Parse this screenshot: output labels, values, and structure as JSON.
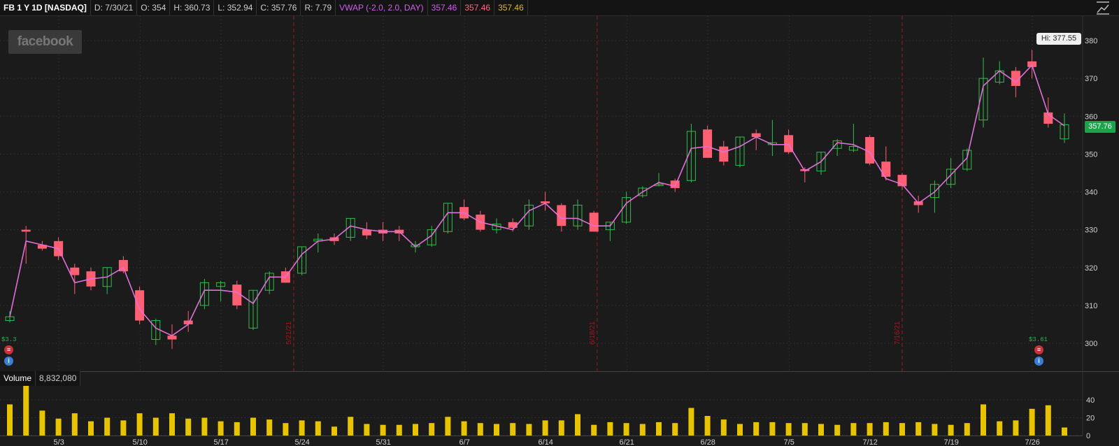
{
  "header": {
    "symbol": "FB 1 Y 1D [NASDAQ]",
    "date": "D: 7/30/21",
    "open": "O: 354",
    "high": "H: 360.73",
    "low": "L: 352.94",
    "close": "C: 357.76",
    "range": "R: 7.79",
    "study": "VWAP (-2.0, 2.0, DAY)",
    "study_values": [
      "357.46",
      "357.46",
      "357.46"
    ]
  },
  "logo_text": "facebook",
  "last_price": "357.76",
  "high_label": "Hi: 377.55",
  "volume_panel": {
    "title": "Volume",
    "value": "8,832,080"
  },
  "events": [
    {
      "label": "$3.3"
    },
    {
      "label": "$3.61"
    }
  ],
  "colors": {
    "up": "#2fbf4a",
    "down": "#ff5f73",
    "vwap": "#e070d8",
    "volume": "#e8c400",
    "separator": "#a0181c",
    "grid": "#3b3b3b",
    "price_tag": "#1aa34a"
  },
  "chart_data": [
    {
      "type": "candlestick",
      "title": "FB 1 Y 1D [NASDAQ]",
      "y_axis_side": "right",
      "ylim": [
        295,
        383
      ],
      "yticks": [
        300,
        310,
        320,
        330,
        340,
        350,
        360,
        370,
        380
      ],
      "xtick_labels": [
        "5/3",
        "5/10",
        "5/17",
        "5/24",
        "5/31",
        "6/7",
        "6/14",
        "6/21",
        "6/28",
        "7/5",
        "7/12",
        "7/19",
        "7/26"
      ],
      "month_separators": [
        "5/21/21",
        "6/18/21",
        "7/16/21"
      ],
      "grid": true,
      "series": [
        {
          "name": "price",
          "ohlc": [
            [
              306,
              308.5,
              305.5,
              307
            ],
            [
              330,
              331,
              321,
              329.5
            ],
            [
              326,
              327,
              324.5,
              325
            ],
            [
              327,
              328,
              322,
              323
            ],
            [
              320,
              321,
              313,
              318
            ],
            [
              319,
              320,
              314,
              315
            ],
            [
              315,
              320,
              313,
              320
            ],
            [
              322,
              323,
              318.5,
              319
            ],
            [
              314,
              315,
              305,
              306
            ],
            [
              301,
              306.5,
              299.5,
              306
            ],
            [
              302,
              305,
              298.5,
              301
            ],
            [
              306,
              308.5,
              303,
              305
            ],
            [
              310,
              317,
              309,
              316
            ],
            [
              315,
              316.5,
              311,
              316
            ],
            [
              315.5,
              316.5,
              309,
              310
            ],
            [
              304,
              314,
              303.5,
              314
            ],
            [
              314,
              319,
              313,
              318.5
            ],
            [
              319,
              320,
              316,
              316
            ],
            [
              318.5,
              325.5,
              318,
              325.5
            ],
            [
              327,
              329,
              324,
              327.5
            ],
            [
              328,
              329,
              326,
              327
            ],
            [
              328,
              333,
              327,
              333
            ],
            [
              330,
              332,
              327.5,
              328.5
            ],
            [
              330,
              332,
              327,
              329
            ],
            [
              330,
              331,
              327,
              329
            ],
            [
              325.5,
              327,
              324,
              326
            ],
            [
              326,
              331,
              325.5,
              330
            ],
            [
              329.5,
              337,
              329,
              337
            ],
            [
              336,
              338,
              332.5,
              333
            ],
            [
              334,
              335,
              329.5,
              330
            ],
            [
              330,
              333,
              329,
              331.5
            ],
            [
              332,
              333,
              329.5,
              330.5
            ],
            [
              331,
              338,
              330,
              336.5
            ],
            [
              337.5,
              340,
              335,
              337
            ],
            [
              336.5,
              337,
              329.5,
              331
            ],
            [
              331,
              338,
              330,
              336.5
            ],
            [
              334.5,
              335,
              329.5,
              329.5
            ],
            [
              330,
              332,
              327,
              332
            ],
            [
              332,
              340,
              331.5,
              338.5
            ],
            [
              339,
              341.5,
              338.5,
              341
            ],
            [
              342,
              345,
              341.5,
              342
            ],
            [
              343,
              343.5,
              340,
              341
            ],
            [
              343,
              358,
              342.5,
              356
            ],
            [
              356.5,
              357.5,
              349,
              349
            ],
            [
              352,
              353.5,
              347,
              348
            ],
            [
              347,
              354.5,
              346.5,
              354.5
            ],
            [
              355.5,
              356.5,
              351,
              354.5
            ],
            [
              352.5,
              359,
              349.5,
              353
            ],
            [
              355,
              356.5,
              350,
              350.5
            ],
            [
              346,
              346.5,
              342.5,
              345.5
            ],
            [
              345.5,
              350.5,
              344.5,
              350.5
            ],
            [
              351.5,
              354,
              349.5,
              353.5
            ],
            [
              351,
              358,
              350.5,
              352
            ],
            [
              354.5,
              355,
              347,
              347.5
            ],
            [
              348,
              352,
              343,
              344
            ],
            [
              344.5,
              345,
              340.5,
              341.5
            ],
            [
              337.5,
              339,
              334.5,
              336.5
            ],
            [
              338.5,
              343,
              334.5,
              342
            ],
            [
              342,
              349,
              341,
              346
            ],
            [
              346,
              351.5,
              345.5,
              351
            ],
            [
              359,
              375.5,
              357,
              370
            ],
            [
              369,
              374.5,
              368.5,
              372
            ],
            [
              372,
              373,
              365,
              368
            ],
            [
              374.5,
              377.55,
              370,
              373
            ],
            [
              361,
              365,
              357,
              358
            ],
            [
              354,
              360.73,
              352.94,
              357.76
            ]
          ]
        },
        {
          "name": "VWAP",
          "values": [
            307,
            327,
            326,
            325,
            316,
            317,
            317.5,
            320,
            309,
            304,
            302,
            305,
            314,
            314,
            313.5,
            310.5,
            317.5,
            317.5,
            323.5,
            327,
            327.5,
            331,
            330,
            329.5,
            329.5,
            325.5,
            328.5,
            334.5,
            334.5,
            332,
            331,
            330,
            335,
            337,
            333,
            333,
            331,
            331,
            337,
            340,
            342.5,
            341.5,
            351.5,
            352,
            350.5,
            352,
            354.5,
            352.5,
            352.5,
            345.5,
            348,
            353,
            352.5,
            350.5,
            343.5,
            342,
            337,
            340,
            344.5,
            349,
            368,
            372,
            369,
            373.5,
            360.5,
            357.46
          ]
        }
      ]
    },
    {
      "type": "bar",
      "title": "Volume",
      "ylim": [
        0,
        55
      ],
      "yticks": [
        0,
        20,
        40
      ],
      "values": [
        35,
        56,
        28,
        19,
        25,
        16,
        20,
        17,
        25,
        20,
        25,
        19,
        20,
        16,
        15,
        20,
        18,
        14,
        17,
        16,
        10,
        21,
        13,
        12,
        12,
        13,
        14,
        21,
        16,
        14,
        13,
        14,
        13,
        17,
        17,
        24,
        12,
        15,
        14,
        13,
        15,
        14,
        31,
        22,
        18,
        13,
        15,
        15,
        14,
        14,
        13,
        12,
        14,
        14,
        15,
        14,
        15,
        13,
        12,
        14,
        35,
        16,
        17,
        30,
        34,
        9
      ]
    }
  ]
}
